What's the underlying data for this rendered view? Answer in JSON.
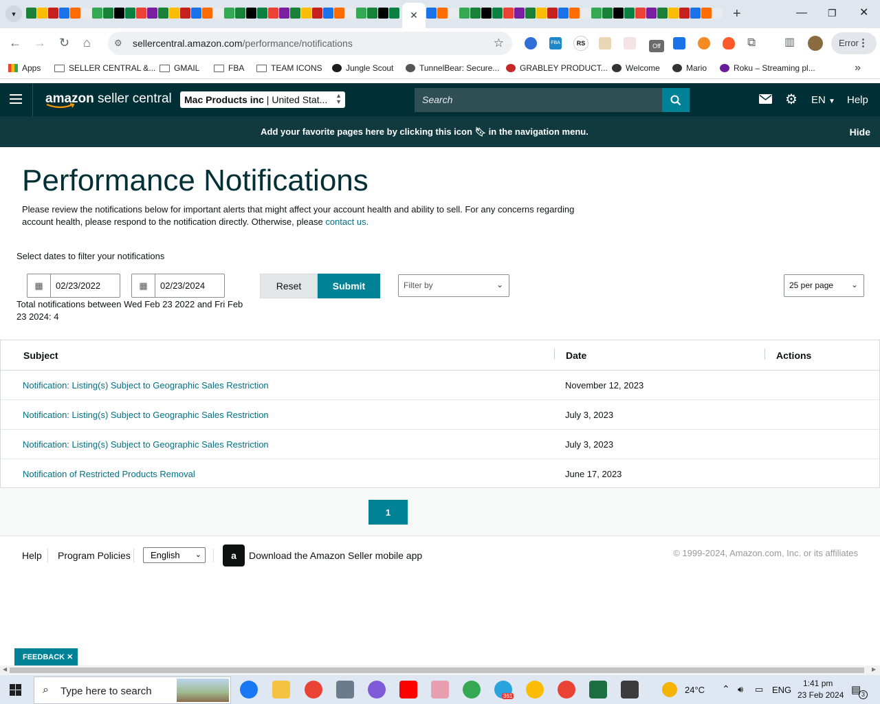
{
  "browser": {
    "url_host": "sellercentral.amazon.com",
    "url_path": "/performance/notifications",
    "error_label": "Error",
    "bookmarks": [
      {
        "label": "Apps",
        "kind": "apps"
      },
      {
        "label": "SELLER CENTRAL &...",
        "kind": "folder"
      },
      {
        "label": "GMAIL",
        "kind": "folder"
      },
      {
        "label": "FBA",
        "kind": "folder"
      },
      {
        "label": "TEAM ICONS",
        "kind": "folder"
      },
      {
        "label": "Jungle Scout",
        "kind": "site"
      },
      {
        "label": "TunnelBear: Secure...",
        "kind": "site"
      },
      {
        "label": "GRABLEY PRODUCT...",
        "kind": "site"
      },
      {
        "label": "Welcome",
        "kind": "site"
      },
      {
        "label": "Mario",
        "kind": "site"
      },
      {
        "label": "Roku – Streaming pl...",
        "kind": "site"
      }
    ],
    "extension_labels": {
      "fba": "FBA",
      "rs": "RS",
      "off": "Off"
    }
  },
  "seller_header": {
    "logo_text_bold": "amazon",
    "logo_text_light": " seller central",
    "account_name": "Mac Products inc",
    "account_marketplace": " | United Stat...",
    "search_placeholder": "Search",
    "language": "EN",
    "help": "Help"
  },
  "favorites_banner": {
    "text_before": "Add your favorite pages here by clicking this icon",
    "text_after": "in the navigation menu.",
    "hide": "Hide"
  },
  "page": {
    "title": "Performance Notifications",
    "description": "Please review the notifications below for important alerts that might affect your account health and ability to sell. For any concerns regarding account health, please respond to the notification directly. Otherwise, please",
    "contact_link": "contact us.",
    "filter_label": "Select dates to filter your notifications",
    "start_date": "02/23/2022",
    "end_date": "02/23/2024",
    "reset": "Reset",
    "submit": "Submit",
    "filter_by": "Filter by",
    "per_page": "25 per page",
    "total_text": "Total notifications between Wed Feb 23 2022 and Fri Feb 23 2024: 4"
  },
  "table": {
    "headers": {
      "subject": "Subject",
      "date": "Date",
      "actions": "Actions"
    },
    "rows": [
      {
        "subject": "Notification: Listing(s) Subject to Geographic Sales Restriction",
        "date": "November 12, 2023"
      },
      {
        "subject": "Notification: Listing(s) Subject to Geographic Sales Restriction",
        "date": "July 3, 2023"
      },
      {
        "subject": "Notification: Listing(s) Subject to Geographic Sales Restriction",
        "date": "July 3, 2023"
      },
      {
        "subject": "Notification of Restricted Products Removal",
        "date": "June 17, 2023"
      }
    ],
    "current_page": "1"
  },
  "footer": {
    "help": "Help",
    "program_policies": "Program Policies",
    "language": "English",
    "app_text": "Download the Amazon Seller mobile app",
    "copyright": "© 1999-2024, Amazon.com, Inc. or its affiliates"
  },
  "feedback": "FEEDBACK ✕",
  "taskbar": {
    "search_placeholder": "Type here to search",
    "weather": "24°C",
    "language": "ENG",
    "time": "1:41 pm",
    "date": "23 Feb 2024",
    "notification_count": "3",
    "telegram_badge": "361"
  },
  "colors": {
    "header_bg": "#002f36",
    "banner_bg": "#103a3f",
    "accent_teal": "#008296",
    "link": "#007185"
  }
}
